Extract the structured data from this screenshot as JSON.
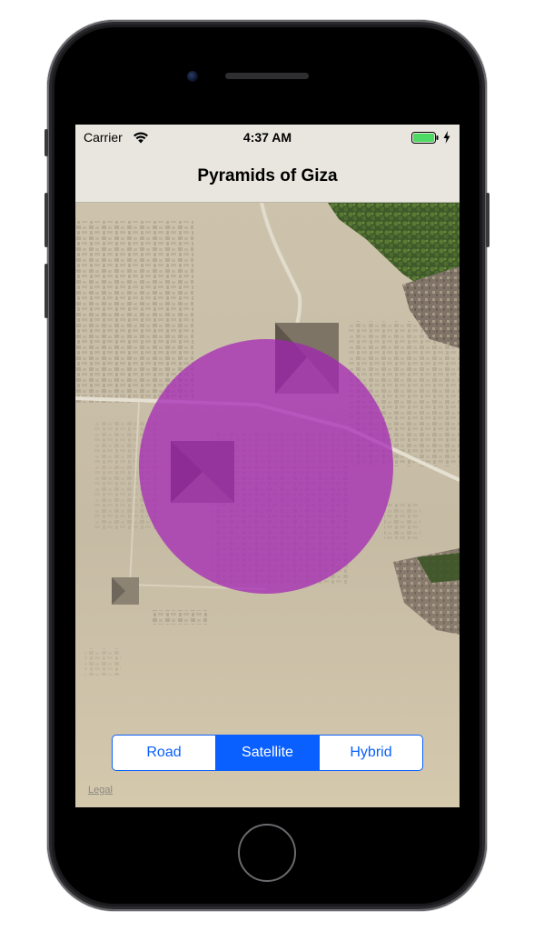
{
  "status_bar": {
    "carrier": "Carrier",
    "time": "4:37 AM",
    "wifi_icon": "wifi-icon",
    "battery_icon": "battery-icon",
    "battery_color": "#4cd964",
    "charging_icon": "lightning-bolt-icon"
  },
  "nav": {
    "title": "Pyramids of Giza"
  },
  "map": {
    "map_type": "satellite",
    "overlay": {
      "shape": "circle",
      "fill_color": "#a321b5",
      "opacity": 0.72
    }
  },
  "map_type_control": {
    "options": [
      "Road",
      "Satellite",
      "Hybrid"
    ],
    "selected": "Satellite",
    "accent_color": "#0a60ff"
  },
  "legal": {
    "label": "Legal"
  }
}
